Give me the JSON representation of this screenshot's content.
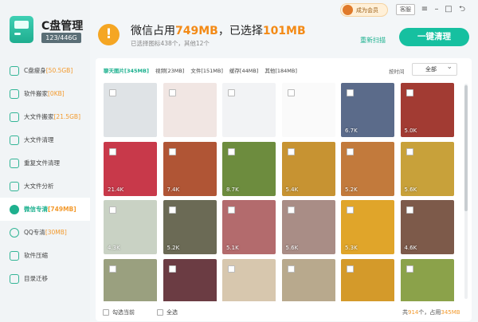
{
  "app": {
    "title": "C盘管理",
    "capacity": "123/446G"
  },
  "topbar": {
    "vip_label": "成为会员",
    "feedback_label": "客服"
  },
  "header": {
    "headline_prefix": "微信占用",
    "headline_used": "749MB",
    "headline_mid": "，已选择",
    "headline_selected": "101MB",
    "subline": "已选择图标438个，其他12个",
    "rescan_label": "重新扫描",
    "clean_label": "一键清理"
  },
  "sidebar": {
    "items": [
      {
        "label": "C盘瘦身",
        "extra": "[50.5GB]",
        "icon": "disk-slim-icon"
      },
      {
        "label": "软件搬家",
        "extra": "[0KB]",
        "icon": "software-move-icon"
      },
      {
        "label": "大文件搬家",
        "extra": "[21.5GB]",
        "icon": "large-file-move-icon"
      },
      {
        "label": "大文件清理",
        "extra": "",
        "icon": "large-file-clean-icon"
      },
      {
        "label": "重复文件清理",
        "extra": "",
        "icon": "duplicate-file-icon"
      },
      {
        "label": "大文件分析",
        "extra": "",
        "icon": "file-analysis-icon"
      },
      {
        "label": "微信专清",
        "extra": "[749MB]",
        "icon": "wechat-icon",
        "active": true
      },
      {
        "label": "QQ专清",
        "extra": "[30MB]",
        "icon": "qq-icon"
      },
      {
        "label": "软件压缩",
        "extra": "",
        "icon": "compress-icon"
      },
      {
        "label": "目录迁移",
        "extra": "",
        "icon": "directory-migrate-icon"
      }
    ]
  },
  "filters": {
    "tabs": [
      {
        "label": "聊天图片[345MB]",
        "active": true
      },
      {
        "label": "视频[23MB]"
      },
      {
        "label": "文件[151MB]"
      },
      {
        "label": "缓存[44MB]"
      },
      {
        "label": "其他[184MB]"
      }
    ],
    "sort_label": "按时间",
    "sort_value": "全部"
  },
  "thumbnails": [
    {
      "bg": "#dfe3e6",
      "size": ""
    },
    {
      "bg": "#f1e6e3",
      "size": ""
    },
    {
      "bg": "#f2f3f5",
      "size": ""
    },
    {
      "bg": "#fafafa",
      "size": ""
    },
    {
      "bg": "#5b6b8a",
      "size": "6.7K"
    },
    {
      "bg": "#a23b33",
      "size": "5.0K"
    },
    {
      "bg": "#c8394a",
      "size": "21.4K"
    },
    {
      "bg": "#b05535",
      "size": "7.4K"
    },
    {
      "bg": "#6d8c3e",
      "size": "8.7K"
    },
    {
      "bg": "#c79332",
      "size": "5.4K"
    },
    {
      "bg": "#c27a3c",
      "size": "5.2K"
    },
    {
      "bg": "#c8a13a",
      "size": "5.6K"
    },
    {
      "bg": "#c9d2c4",
      "size": "4.3K"
    },
    {
      "bg": "#6b6a55",
      "size": "5.2K"
    },
    {
      "bg": "#b36b6d",
      "size": "5.1K"
    },
    {
      "bg": "#a98d86",
      "size": "5.6K"
    },
    {
      "bg": "#e0a52a",
      "size": "5.3K"
    },
    {
      "bg": "#7d5a4a",
      "size": "4.6K"
    },
    {
      "bg": "#9aa07f",
      "size": ""
    },
    {
      "bg": "#6b3c43",
      "size": ""
    },
    {
      "bg": "#d7c7ae",
      "size": ""
    },
    {
      "bg": "#b8a98d",
      "size": ""
    },
    {
      "bg": "#d49a2a",
      "size": ""
    },
    {
      "bg": "#8ba24a",
      "size": ""
    }
  ],
  "footer": {
    "select_current": "勾选当前",
    "select_all": "全选",
    "total_prefix": "共",
    "total_count": "914",
    "total_mid": "个，占用",
    "total_size": "345MB"
  }
}
